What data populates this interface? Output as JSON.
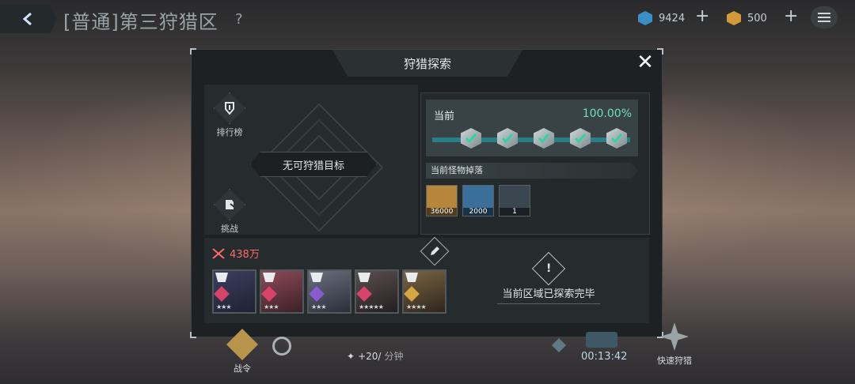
{
  "header": {
    "stage_title": "[普通]第三狩猎区",
    "help": "?",
    "currency": [
      {
        "icon": "crystal-icon",
        "value": "9424",
        "color": "#3a8fc7"
      },
      {
        "icon": "gold-cube-icon",
        "value": "500",
        "color": "#d49a3a"
      }
    ],
    "plus": "+"
  },
  "modal": {
    "title": "狩猎探索",
    "close": "✕",
    "ranking_label": "排行榜",
    "challenge_label": "挑战",
    "no_target": "无可狩猎目标",
    "progress": {
      "label": "当前",
      "percent": "100.00%",
      "nodes_completed": 5,
      "nodes_total": 5
    },
    "drops_title": "当前怪物掉落",
    "drops": [
      {
        "icon": "gold-ingot-icon",
        "count": "36000",
        "color": "#b8863a"
      },
      {
        "icon": "blue-crystal-icon",
        "count": "2000",
        "color": "#3a6f9a"
      },
      {
        "icon": "bullet-icon",
        "count": "1",
        "color": "#3b4750"
      }
    ],
    "power": "438万",
    "team": [
      {
        "name": "character-1",
        "color": "#3b3f5e",
        "elem": "#d8436a",
        "stars": "★★★"
      },
      {
        "name": "character-2",
        "color": "#8f4a5a",
        "elem": "#d8436a",
        "stars": "★★★"
      },
      {
        "name": "character-3",
        "color": "#6a6f80",
        "elem": "#8a5ad0",
        "stars": "★★★"
      },
      {
        "name": "character-4",
        "color": "#5a4f50",
        "elem": "#d8436a",
        "stars": "★★★★★"
      },
      {
        "name": "character-5",
        "color": "#7a6546",
        "elem": "#d6a742",
        "stars": "★★★★"
      }
    ],
    "explored_text": "当前区域已探索完毕"
  },
  "hud": {
    "battle_pass": "战令",
    "rate_value": "+20/",
    "rate_unit": "分钟",
    "timer": "00:13:42",
    "quick_hunt": "快速狩猎"
  }
}
